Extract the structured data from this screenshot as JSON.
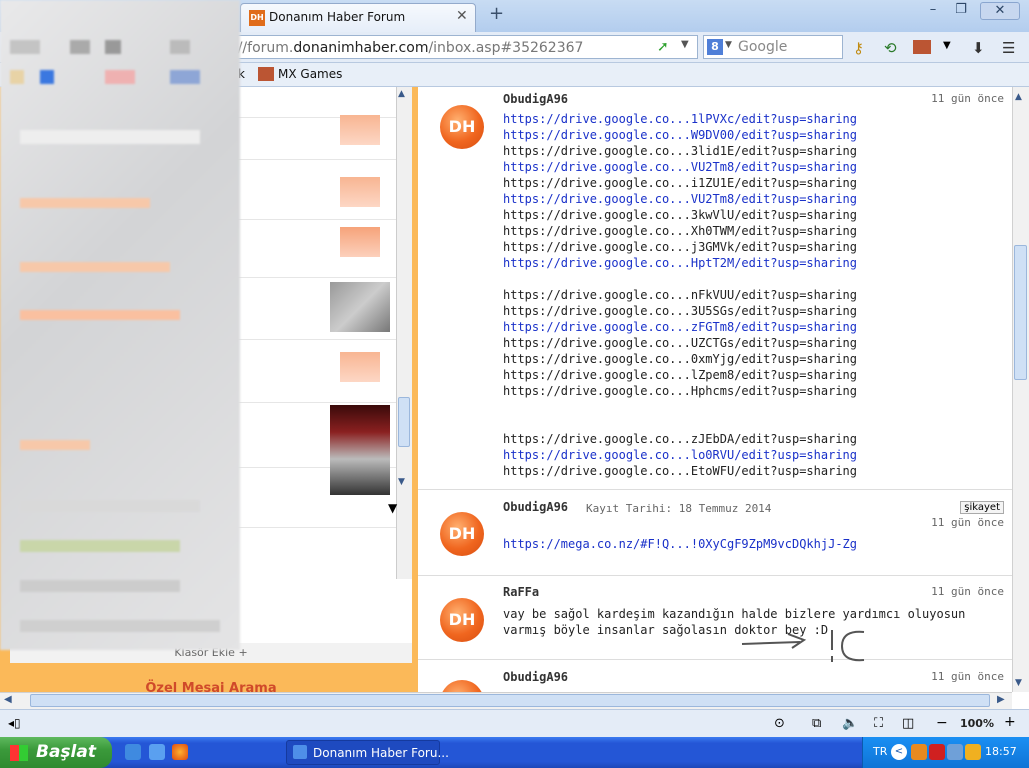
{
  "browser": {
    "tab_title": "Donanım Haber Forum",
    "tab_icon_text": "DH",
    "url_prefix": "://forum.",
    "url_domain": "donanimhaber.com",
    "url_suffix": "/inbox.asp#35262367",
    "search_placeholder": "Google",
    "search_engine_letter": "8",
    "bookmark_partial": "k",
    "bookmark_mx": "MX Games"
  },
  "left_pane": {
    "folder_add": "Klasör Ekle +",
    "header_partial": "Özel Mesaj Arama"
  },
  "messages": [
    {
      "user": "ObudigA96",
      "date": "11 gün önce",
      "lines": [
        {
          "text": "https://drive.google.co...1lPVXc/edit?usp=sharing",
          "link": true
        },
        {
          "text": "https://drive.google.co...W9DV00/edit?usp=sharing",
          "link": true
        },
        {
          "text": "https://drive.google.co...3lid1E/edit?usp=sharing",
          "link": false
        },
        {
          "text": "https://drive.google.co...VU2Tm8/edit?usp=sharing",
          "link": true
        },
        {
          "text": "https://drive.google.co...i1ZU1E/edit?usp=sharing",
          "link": false
        },
        {
          "text": "https://drive.google.co...VU2Tm8/edit?usp=sharing",
          "link": true
        },
        {
          "text": "https://drive.google.co...3kwVlU/edit?usp=sharing",
          "link": false
        },
        {
          "text": "https://drive.google.co...Xh0TWM/edit?usp=sharing",
          "link": false
        },
        {
          "text": "https://drive.google.co...j3GMVk/edit?usp=sharing",
          "link": false
        },
        {
          "text": "https://drive.google.co...HptT2M/edit?usp=sharing",
          "link": true
        },
        {
          "text": "",
          "link": false
        },
        {
          "text": "https://drive.google.co...nFkVUU/edit?usp=sharing",
          "link": false
        },
        {
          "text": "https://drive.google.co...3U5SGs/edit?usp=sharing",
          "link": false
        },
        {
          "text": "https://drive.google.co...zFGTm8/edit?usp=sharing",
          "link": true
        },
        {
          "text": "https://drive.google.co...UZCTGs/edit?usp=sharing",
          "link": false
        },
        {
          "text": "https://drive.google.co...0xmYjg/edit?usp=sharing",
          "link": false
        },
        {
          "text": "https://drive.google.co...lZpem8/edit?usp=sharing",
          "link": false
        },
        {
          "text": "https://drive.google.co...Hphcms/edit?usp=sharing",
          "link": false
        },
        {
          "text": "",
          "link": false
        },
        {
          "text": "",
          "link": false
        },
        {
          "text": "https://drive.google.co...zJEbDA/edit?usp=sharing",
          "link": false
        },
        {
          "text": "https://drive.google.co...lo0RVU/edit?usp=sharing",
          "link": true
        },
        {
          "text": "https://drive.google.co...EtoWFU/edit?usp=sharing",
          "link": false
        }
      ]
    },
    {
      "user": "ObudigA96",
      "registered": "Kayıt Tarihi: 18 Temmuz 2014",
      "report": "şikayet",
      "date": "11 gün önce",
      "link": "https://mega.co.nz/#F!Q...!0XyCgF9ZpM9vcDQkhjJ-Zg"
    },
    {
      "user": "RaFFa",
      "date": "11 gün önce",
      "body": "vay be sağol kardeşim kazandığın halde bizlere yardımcı oluyosun varmış böyle insanlar sağolasın doktor bey :D"
    },
    {
      "user": "ObudigA96",
      "date": "11 gün önce"
    }
  ],
  "avatar_text": "DH",
  "statusbar": {
    "zoom": "100%"
  },
  "taskbar": {
    "start_label": "Başlat",
    "task_label": "Donanım Haber Foru...",
    "lang": "TR",
    "clock": "18:57"
  },
  "colors": {
    "accent": "#fbb959",
    "link": "#1a31c9",
    "brand": "#f0661f"
  }
}
